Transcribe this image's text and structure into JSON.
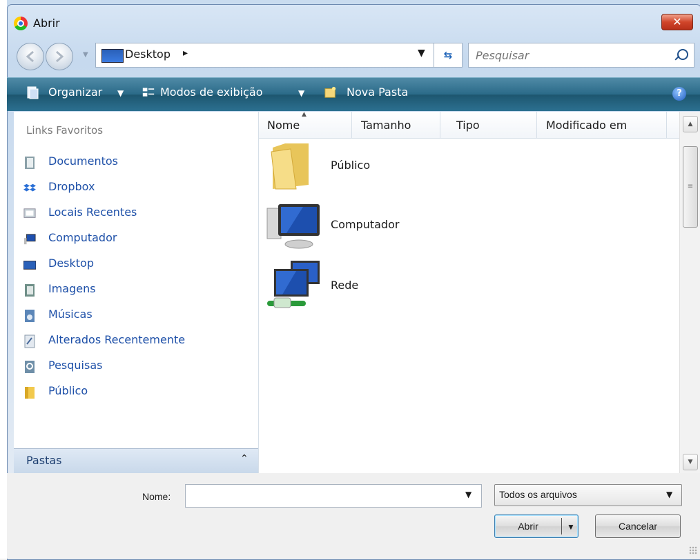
{
  "window": {
    "title": "Abrir",
    "close_label": "✕"
  },
  "nav": {
    "address_label": "Desktop",
    "address_separator": "▸",
    "search_placeholder": "Pesquisar"
  },
  "toolbar": {
    "organize": "Organizar",
    "views": "Modos de exibição",
    "new_folder": "Nova Pasta",
    "help": "?"
  },
  "sidebar": {
    "title": "Links Favoritos",
    "items": [
      {
        "label": "Documentos",
        "icon": "documents-icon"
      },
      {
        "label": "Dropbox",
        "icon": "dropbox-icon"
      },
      {
        "label": "Locais Recentes",
        "icon": "recent-places-icon"
      },
      {
        "label": "Computador",
        "icon": "computer-icon"
      },
      {
        "label": "Desktop",
        "icon": "desktop-icon"
      },
      {
        "label": "Imagens",
        "icon": "pictures-icon"
      },
      {
        "label": "Músicas",
        "icon": "music-icon"
      },
      {
        "label": "Alterados Recentemente",
        "icon": "recently-changed-icon"
      },
      {
        "label": "Pesquisas",
        "icon": "searches-icon"
      },
      {
        "label": "Público",
        "icon": "public-folder-icon"
      }
    ],
    "folders_label": "Pastas",
    "folders_chevron": "⌃"
  },
  "columns": [
    "Nome",
    "Tamanho",
    "Tipo",
    "Modificado em"
  ],
  "files": [
    {
      "name": "Público",
      "icon": "folder-icon"
    },
    {
      "name": "Computador",
      "icon": "computer-icon"
    },
    {
      "name": "Rede",
      "icon": "network-icon"
    }
  ],
  "footer": {
    "name_label": "Nome:",
    "name_value": "",
    "filter_value": "Todos os arquivos",
    "open_label": "Abrir",
    "cancel_label": "Cancelar"
  }
}
